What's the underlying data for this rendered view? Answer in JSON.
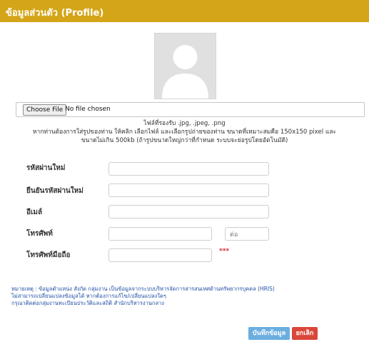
{
  "header": {
    "title": "ข้อมูลส่วนตัว (Profile)"
  },
  "file": {
    "button_label": "Choose File",
    "status": "No file chosen"
  },
  "notes": {
    "line1": "ไฟล์ที่รองรับ .jpg, .jpeg, .png",
    "line2": "หากท่านต้องการใส่รูปของท่าน ให้คลิก เลือกไฟล์ และเลือกรูปถ่ายของท่าน ขนาดที่เหมาะสมคือ 150x150 pixel และ",
    "line3": "ขนาดไม่เกิน 500kb (ถ้ารูปขนาดใหญ่กว่าที่กำหนด ระบบจะย่อรูปโดยอัตโนมัติ)"
  },
  "form": {
    "new_password": {
      "label": "รหัสผ่านใหม่",
      "value": ""
    },
    "confirm_password": {
      "label": "ยืนยันรหัสผ่านใหม่",
      "value": ""
    },
    "email": {
      "label": "อีเมล์",
      "value": ""
    },
    "phone": {
      "label": "โทรศัพท์",
      "value": "",
      "ext_placeholder": "ต่อ"
    },
    "mobile": {
      "label": "โทรศัพท์มือถือ",
      "value": "",
      "required_mark": "***"
    }
  },
  "remarks": {
    "line1": "หมายเหตุ : ข้อมูลตำแหน่ง สังกัด กลุ่มงาน เป็นข้อมูลจากระบบบริหารจัดการสารสนเทศด้านทรัพยากรบุคคล (HRIS)",
    "line2": "ไม่สามารถเปลี่ยนแปลงข้อมูลได้ หากต้องการแก้ไข/เปลี่ยนแปลงใดๆ",
    "line3": "กรุณาติดต่อกลุ่มงานทะเบียนประวัติและสถิติ สำนักบริหารงานกลาง"
  },
  "actions": {
    "save_label": "บันทึกข้อมูล",
    "cancel_label": "ยกเลิก"
  },
  "colors": {
    "header": "#d4a518",
    "save": "#6baee0",
    "cancel": "#d9473b",
    "required": "#d9232d",
    "remark": "#1f4fa3"
  }
}
